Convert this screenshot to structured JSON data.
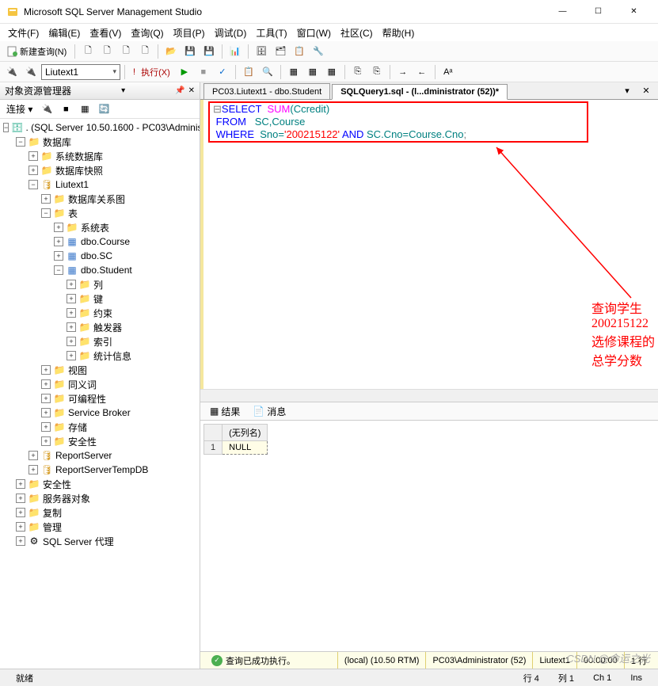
{
  "app": {
    "title": "Microsoft SQL Server Management Studio"
  },
  "winbtns": {
    "min": "—",
    "max": "☐",
    "close": "✕"
  },
  "menu": [
    "文件(F)",
    "编辑(E)",
    "查看(V)",
    "查询(Q)",
    "项目(P)",
    "调试(D)",
    "工具(T)",
    "窗口(W)",
    "社区(C)",
    "帮助(H)"
  ],
  "toolbar1": {
    "newquery": "新建查询(N)",
    "dbcombo": "Liutext1",
    "execute": "执行(X)"
  },
  "objexp": {
    "title": "对象资源管理器",
    "connect": "连接 ▾",
    "root": ". (SQL Server 10.50.1600 - PC03\\Administ",
    "nodes": {
      "databases": "数据库",
      "sysdb": "系统数据库",
      "dbsnap": "数据库快照",
      "liu": "Liutext1",
      "dbrel": "数据库关系图",
      "tables": "表",
      "systables": "系统表",
      "course": "dbo.Course",
      "sc": "dbo.SC",
      "student": "dbo.Student",
      "cols": "列",
      "keys": "键",
      "cons": "约束",
      "trig": "触发器",
      "idx": "索引",
      "stats": "统计信息",
      "views": "视图",
      "syn": "同义词",
      "prog": "可编程性",
      "sb": "Service Broker",
      "stor": "存储",
      "sec": "安全性",
      "rs": "ReportServer",
      "rst": "ReportServerTempDB",
      "top_sec": "安全性",
      "srvobj": "服务器对象",
      "repl": "复制",
      "mgmt": "管理",
      "agent": "SQL Server 代理"
    }
  },
  "tabs": {
    "t1": "PC03.Liutext1 - dbo.Student",
    "t2": "SQLQuery1.sql - (l...dministrator (52))*"
  },
  "sql": {
    "l1a": "SELECT",
    "l1b": "SUM",
    "l1c": "(Ccredit)",
    "l2a": "FROM",
    "l2b": "SC,Course",
    "l3a": "WHERE",
    "l3b": "Sno=",
    "l3c": "'200215122'",
    "l3d": "AND",
    "l3e": "SC.Cno=Course.Cno",
    "l3f": ";"
  },
  "annotation": "查询学生200215122选修课程的总学分数",
  "results": {
    "tab1": "结果",
    "tab2": "消息",
    "colhdr": "(无列名)",
    "row1": "1",
    "val1": "NULL"
  },
  "qstatus": {
    "msg": "查询已成功执行。",
    "srv": "(local) (10.50 RTM)",
    "user": "PC03\\Administrator (52)",
    "db": "Liutext1",
    "time": "00:00:00",
    "rows": "1 行"
  },
  "status": {
    "ready": "就绪",
    "line": "行 4",
    "col": "列 1",
    "ch": "Ch 1",
    "ins": "Ins"
  },
  "watermark": "CSDN @命运之光"
}
